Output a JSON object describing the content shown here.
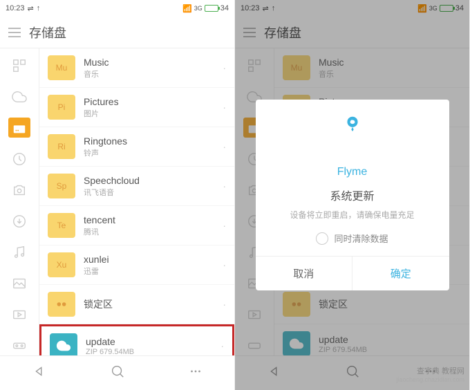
{
  "status": {
    "time": "10:23",
    "battery": "34"
  },
  "header": {
    "title": "存储盘"
  },
  "files": [
    {
      "short": "Mu",
      "name": "Music",
      "sub": "音乐",
      "cls": "folder-yellow"
    },
    {
      "short": "Pi",
      "name": "Pictures",
      "sub": "图片",
      "cls": "folder-yellow"
    },
    {
      "short": "Ri",
      "name": "Ringtones",
      "sub": "铃声",
      "cls": "folder-yellow"
    },
    {
      "short": "Sp",
      "name": "Speechcloud",
      "sub": "讯飞语音",
      "cls": "folder-yellow"
    },
    {
      "short": "Te",
      "name": "tencent",
      "sub": "腾讯",
      "cls": "folder-yellow"
    },
    {
      "short": "Xu",
      "name": "xunlei",
      "sub": "迅雷",
      "cls": "folder-yellow"
    },
    {
      "short": "",
      "name": "锁定区",
      "sub": "",
      "cls": "folder-yellow",
      "icon": "glasses"
    },
    {
      "short": "",
      "name": "update",
      "sub": "ZIP 679.54MB",
      "cls": "folder-teal",
      "icon": "cloud"
    }
  ],
  "dialog": {
    "brand": "Flyme",
    "title": "系统更新",
    "message": "设备将立即重启，请确保电量充足",
    "checkbox": "同时清除数据",
    "cancel": "取消",
    "confirm": "确定"
  },
  "watermark": {
    "main": "查字典 教程网",
    "sub": "jiaocheng.chazidian.com"
  }
}
